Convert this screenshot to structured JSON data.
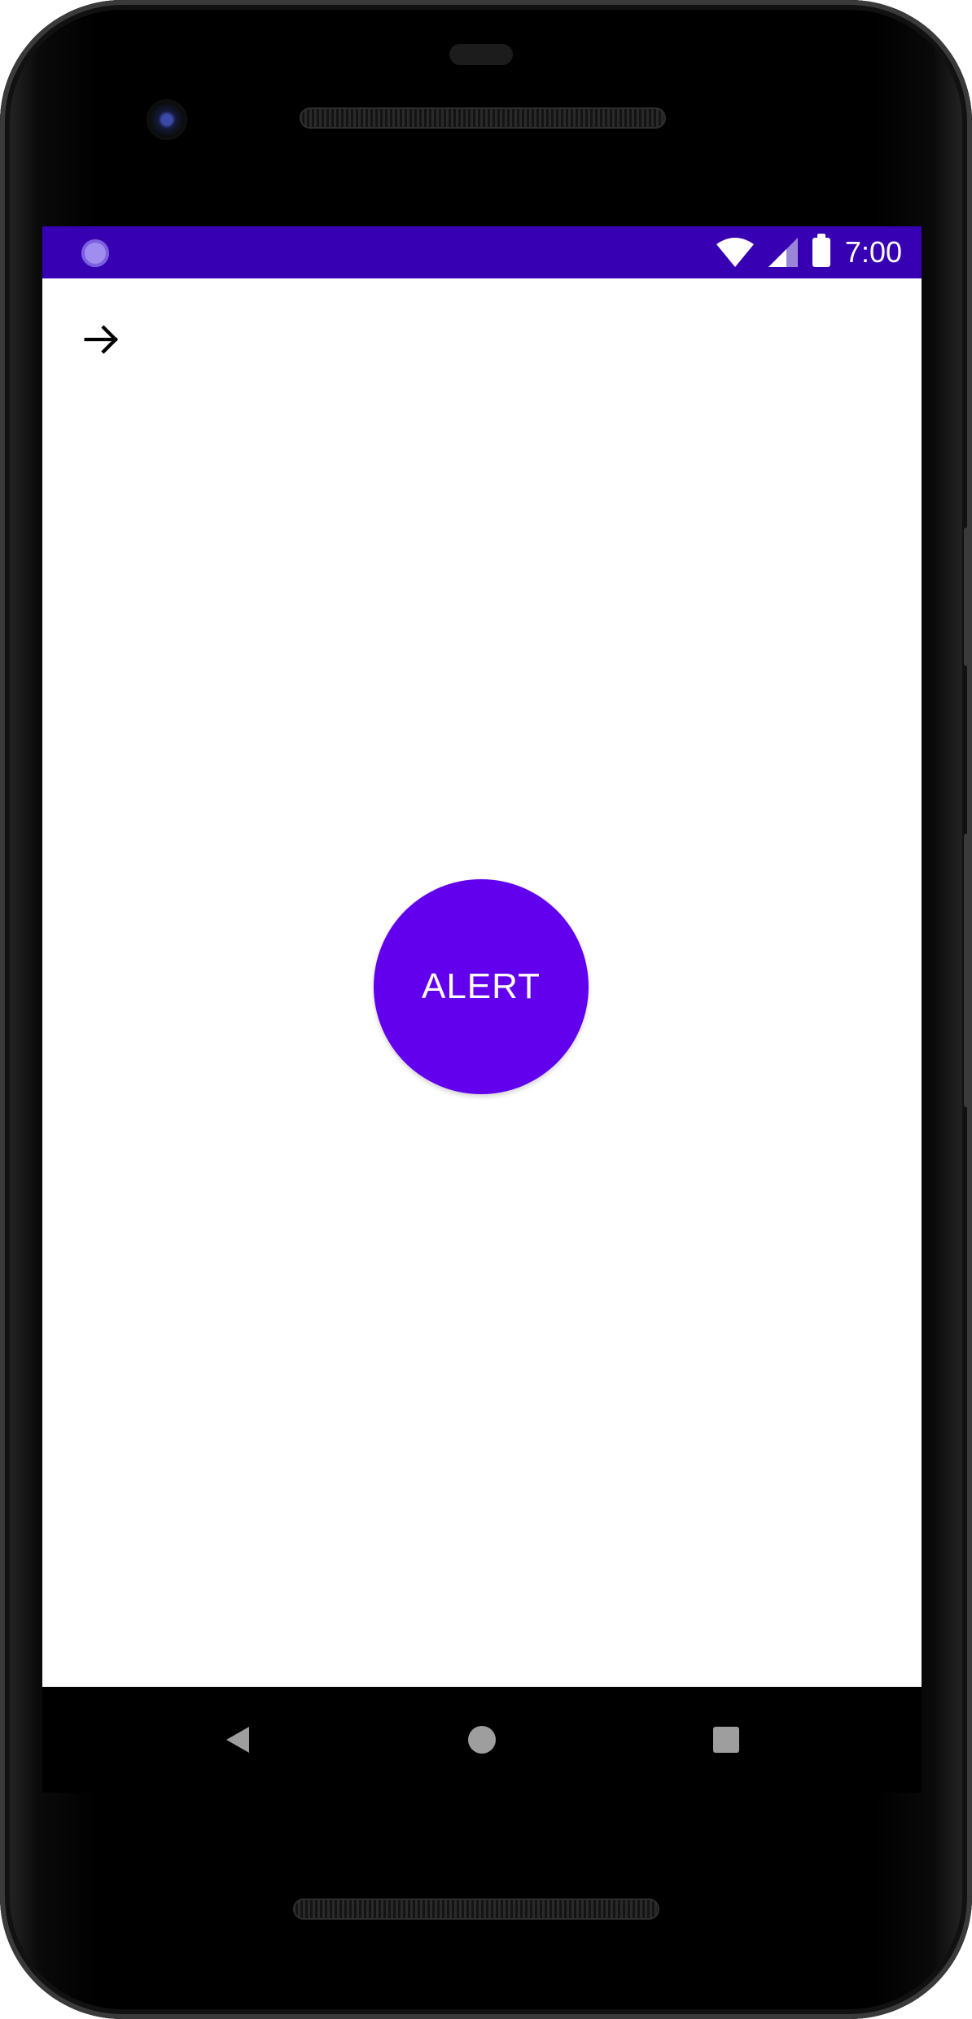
{
  "status_bar": {
    "time": "7:00",
    "background_color": "#3700b3",
    "icons": [
      "app-notification-icon",
      "wifi-icon",
      "cell-signal-icon",
      "battery-icon"
    ]
  },
  "toolbar": {
    "nav_icon": "arrow-forward-icon"
  },
  "main": {
    "alert_button_label": "ALERT",
    "alert_button_color": "#6200ee"
  },
  "nav_bar": {
    "buttons": [
      "back-icon",
      "home-icon",
      "recents-icon"
    ]
  }
}
